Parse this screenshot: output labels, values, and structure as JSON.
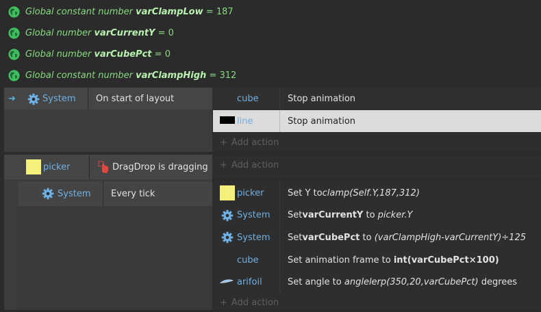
{
  "globals": [
    {
      "prefix": "Global constant number",
      "name": "varClampLow",
      "suffix": " = ",
      "value": "187"
    },
    {
      "prefix": "Global number",
      "name": "varCurrentY",
      "suffix": " = ",
      "value": "0"
    },
    {
      "prefix": "Global number",
      "name": "varCubePct",
      "suffix": " = ",
      "value": "0"
    },
    {
      "prefix": "Global constant number",
      "name": "varClampHigh",
      "suffix": " = ",
      "value": "312"
    }
  ],
  "event1": {
    "condition": {
      "object": "System",
      "text": "On start of layout"
    },
    "actions": [
      {
        "object": "cube",
        "text": "Stop animation"
      },
      {
        "object": "line",
        "text": "Stop animation"
      }
    ],
    "add_action": "Add action"
  },
  "event2": {
    "condition": {
      "object": "picker",
      "text": "DragDrop is dragging"
    },
    "add_action": "Add action"
  },
  "event3": {
    "condition": {
      "object": "System",
      "text": "Every tick"
    },
    "actions": [
      {
        "object": "picker",
        "p1": "Set Y to ",
        "p2": "clamp(Self.Y,187,312)"
      },
      {
        "object": "System",
        "p1": "Set ",
        "p2": "varCurrentY",
        "p3": " to ",
        "p4": "picker.Y"
      },
      {
        "object": "System",
        "p1": "Set ",
        "p2": "varCubePct",
        "p3": " to ",
        "p4": "(varClampHigh-varCurrentY)÷125"
      },
      {
        "object": "cube",
        "p1": "Set animation frame to ",
        "p2": "int(varCubePct×100)"
      },
      {
        "object": "arifoil",
        "p1": "Set angle to ",
        "p2": "anglelerp(350,20,varCubePct)",
        "p3": " degrees"
      }
    ],
    "add_action": "Add action"
  },
  "colors": {
    "globe": "#3fbf5f",
    "object": "#6fb0e3",
    "picker": "#f5f07a",
    "dragdrop": "#e0473e"
  }
}
